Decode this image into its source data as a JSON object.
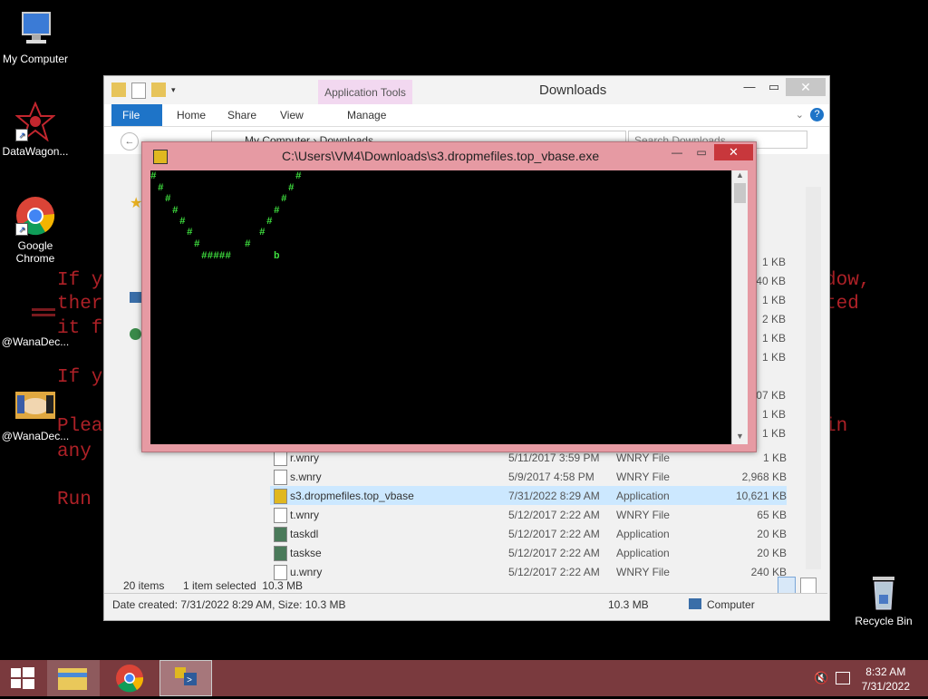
{
  "wallpaper": {
    "lines": [
      {
        "text": "If y",
        "top": 0
      },
      {
        "text": "ther",
        "top": 0
      },
      {
        "text": "it f",
        "top": 0
      },
      {
        "text": "If y",
        "top": 0
      },
      {
        "text": "Plea",
        "top": 0
      },
      {
        "text": "any",
        "top": 0
      },
      {
        "text": "Run",
        "top": 0
      }
    ],
    "right_lines": [
      "dow,",
      "ted",
      "in"
    ]
  },
  "desktop_icons": {
    "my_computer": "My Computer",
    "datawagon": "DataWagon...",
    "chrome_line1": "Google",
    "chrome_line2": "Chrome",
    "wanadec1": "@WanaDec...",
    "wanadec2": "@WanaDec...",
    "recycle": "Recycle Bin"
  },
  "explorer": {
    "title": "Downloads",
    "context_tab": "Application Tools",
    "tabs": [
      "File",
      "Home",
      "Share",
      "View",
      "Manage"
    ],
    "breadcrumb": "My Computer  ›  Downloads",
    "search_placeholder": "Search Downloads",
    "right_sizes": [
      "1 KB",
      "240 KB",
      "1 KB",
      "2 KB",
      "1 KB",
      "1 KB",
      "407 KB",
      "1 KB",
      "1 KB"
    ],
    "files": [
      {
        "name": "r.wnry",
        "date": "5/11/2017 3:59 PM",
        "type": "WNRY File",
        "size": "1 KB",
        "selected": false
      },
      {
        "name": "s.wnry",
        "date": "5/9/2017 4:58 PM",
        "type": "WNRY File",
        "size": "2,968 KB",
        "selected": false
      },
      {
        "name": "s3.dropmefiles.top_vbase",
        "date": "7/31/2022 8:29 AM",
        "type": "Application",
        "size": "10,621 KB",
        "selected": true
      },
      {
        "name": "t.wnry",
        "date": "5/12/2017 2:22 AM",
        "type": "WNRY File",
        "size": "65 KB",
        "selected": false
      },
      {
        "name": "taskdl",
        "date": "5/12/2017 2:22 AM",
        "type": "Application",
        "size": "20 KB",
        "selected": false
      },
      {
        "name": "taskse",
        "date": "5/12/2017 2:22 AM",
        "type": "Application",
        "size": "20 KB",
        "selected": false
      },
      {
        "name": "u.wnry",
        "date": "5/12/2017 2:22 AM",
        "type": "WNRY File",
        "size": "240 KB",
        "selected": false
      }
    ],
    "status_items": "20 items",
    "status_selected": "1 item selected  10.3 MB",
    "details_left": "Date created: 7/31/2022 8:29 AM, Size: 10.3 MB",
    "details_size": "10.3 MB",
    "details_location": "Computer"
  },
  "console": {
    "title": "C:\\Users\\VM4\\Downloads\\s3.dropmefiles.top_vbase.exe",
    "hash": "#",
    "bottom_run": "#####",
    "letter": "b"
  },
  "taskbar": {
    "time": "8:32 AM",
    "date": "7/31/2022"
  },
  "colors": {
    "ransom_red": "#b8232a",
    "console_green": "#3fe03f",
    "console_frame": "#e69aa3",
    "taskbar": "#7a3a3e",
    "file_tab": "#1e74c8"
  }
}
